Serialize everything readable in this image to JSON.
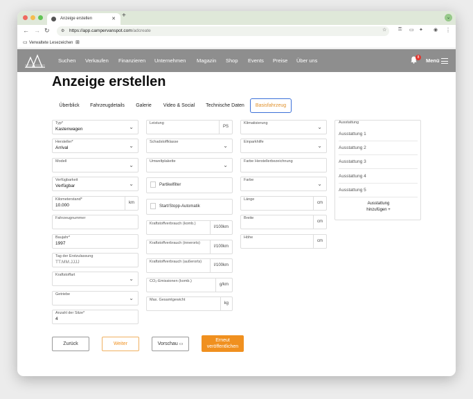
{
  "browser": {
    "tab_title": "Anzeige erstellen",
    "url_host": "https://app.campervanspot.com",
    "url_path": "/adcreate",
    "bookmark_folder": "Verwaltete Lesezeichen",
    "colors": {
      "tabbar": "#dfe8d9",
      "close": "#ef6a5f",
      "minimize": "#f5bd4f",
      "zoom": "#61c455"
    }
  },
  "site_nav": {
    "links": [
      "Suchen",
      "Verkaufen",
      "Finanzieren",
      "Unternehmen",
      "Magazin",
      "Shop",
      "Events",
      "Preise",
      "Über uns"
    ],
    "notification_count": "8",
    "menu_label": "Menü"
  },
  "page": {
    "title": "Anzeige erstellen",
    "tabs": [
      "Überblick",
      "Fahrzeugdetails",
      "Galerie",
      "Video & Social",
      "Technische Daten",
      "Basisfahrzeug"
    ],
    "active_tab": "Basisfahrzeug"
  },
  "col1": {
    "typ": {
      "label": "Typ*",
      "value": "Kastenwagen"
    },
    "hersteller": {
      "label": "Hersteller*",
      "value": "Arrival"
    },
    "modell": {
      "label": "Modell",
      "value": ""
    },
    "verfuegbarkeit": {
      "label": "Verfügbarkeit",
      "value": "Verfügbar"
    },
    "km": {
      "label": "Kilometerstand*",
      "value": "10.000",
      "unit": "km"
    },
    "fahrzeugnummer": {
      "label": "Fahrzeugnummer",
      "value": ""
    },
    "baujahr": {
      "label": "Baujahr*",
      "value": "1997"
    },
    "erstzulassung": {
      "label": "Tag der Erstzulassung",
      "placeholder": "TT.MM.JJJJ"
    },
    "kraftstoffart": {
      "label": "Kraftstoffart",
      "value": ""
    },
    "getriebe": {
      "label": "Getriebe",
      "value": ""
    },
    "sitze": {
      "label": "Anzahl der Sitze*",
      "value": "4"
    }
  },
  "col2": {
    "leistung": {
      "label": "Leistung",
      "unit": "PS"
    },
    "schadstoffklasse": {
      "label": "Schadstoffklasse"
    },
    "umweltplakette": {
      "label": "Umweltplakette"
    },
    "partikelfilter": {
      "label": "Partikelfilter"
    },
    "startstopp": {
      "label": "Start/Stopp-Automatik"
    },
    "verbrauch_komb": {
      "label": "Kraftstoffverbrauch (komb.)",
      "unit": "l/100km"
    },
    "verbrauch_inner": {
      "label": "Kraftstoffverbrauch (innerorts)",
      "unit": "l/100km"
    },
    "verbrauch_ausser": {
      "label": "Kraftstoffverbrauch (außerorts)",
      "unit": "l/100km"
    },
    "co2": {
      "label": "CO₂-Emissionen (komb.)",
      "unit": "g/km"
    },
    "gewicht": {
      "label": "Max. Gesamtgewicht",
      "unit": "kg"
    }
  },
  "col3": {
    "klimatisierung": {
      "label": "Klimatisierung"
    },
    "einparkhilfe": {
      "label": "Einparkhilfe"
    },
    "farbe_hersteller": {
      "label": "Farbe Herstellerbezeichnung"
    },
    "farbe": {
      "label": "Farbe"
    },
    "laenge": {
      "label": "Länge",
      "unit": "cm"
    },
    "breite": {
      "label": "Breite",
      "unit": "cm"
    },
    "hoehe": {
      "label": "Höhe",
      "unit": "cm"
    }
  },
  "ausstattung": {
    "title": "Ausstattung",
    "items": [
      "Ausstattung 1",
      "Ausstattung 2",
      "Ausstattung 3",
      "Ausstattung 4",
      "Ausstattung 5"
    ],
    "add_line1": "Ausstattung",
    "add_line2": "hinzufügen +"
  },
  "buttons": {
    "back": "Zurück",
    "next": "Weiter",
    "preview": "Vorschau",
    "republish_line1": "Erneut",
    "republish_line2": "veröffentlichen",
    "accent": "#f0901f"
  }
}
